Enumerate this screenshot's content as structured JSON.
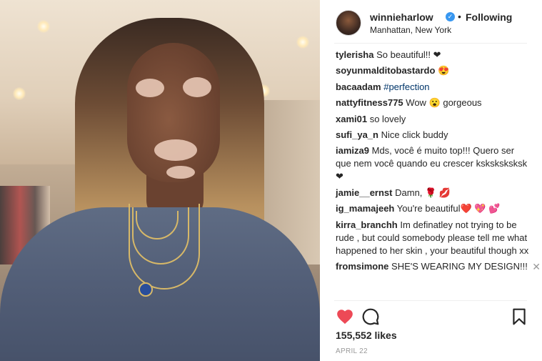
{
  "post": {
    "username": "winnieharlow",
    "verified_icon": "verified-badge-icon",
    "separator": "•",
    "follow_status": "Following",
    "location": "Manhattan, New York"
  },
  "comments": [
    {
      "user": "tylerisha",
      "text": "So beautiful!! ❤"
    },
    {
      "user": "soyunmalditobastardo",
      "text": "😍"
    },
    {
      "user": "bacaadam",
      "text": "#perfection",
      "is_tag": true
    },
    {
      "user": "nattyfitness775",
      "text": "Wow 😮  gorgeous"
    },
    {
      "user": "xami01",
      "text": "so lovely"
    },
    {
      "user": "sufi_ya_n",
      "text": "Nice click buddy"
    },
    {
      "user": "iamiza9",
      "text": "Mds, você é muito top!!! Quero ser que nem você quando eu crescer ksksksksksk❤"
    },
    {
      "user": "jamie__ernst",
      "text": "Damn, 🌹 💋"
    },
    {
      "user": "ig_mamajeeh",
      "text": "You're beautiful❤️ 💖 💕"
    },
    {
      "user": "kirra_branchh",
      "text": "Im definatley not trying to be rude , but could somebody please tell me what happened to her skin , your beautiful though xx"
    },
    {
      "user": "fromsimone",
      "text": "SHE'S WEARING MY DESIGN!!!",
      "has_close": true,
      "close_label": "✕"
    }
  ],
  "actions": {
    "like_icon": "heart-icon",
    "comment_icon": "comment-icon",
    "save_icon": "bookmark-icon"
  },
  "likes": "155,552 likes",
  "date": "APRIL 22",
  "colors": {
    "like_red": "#ed4956",
    "link_blue": "#003569",
    "verified_blue": "#3897f0"
  }
}
